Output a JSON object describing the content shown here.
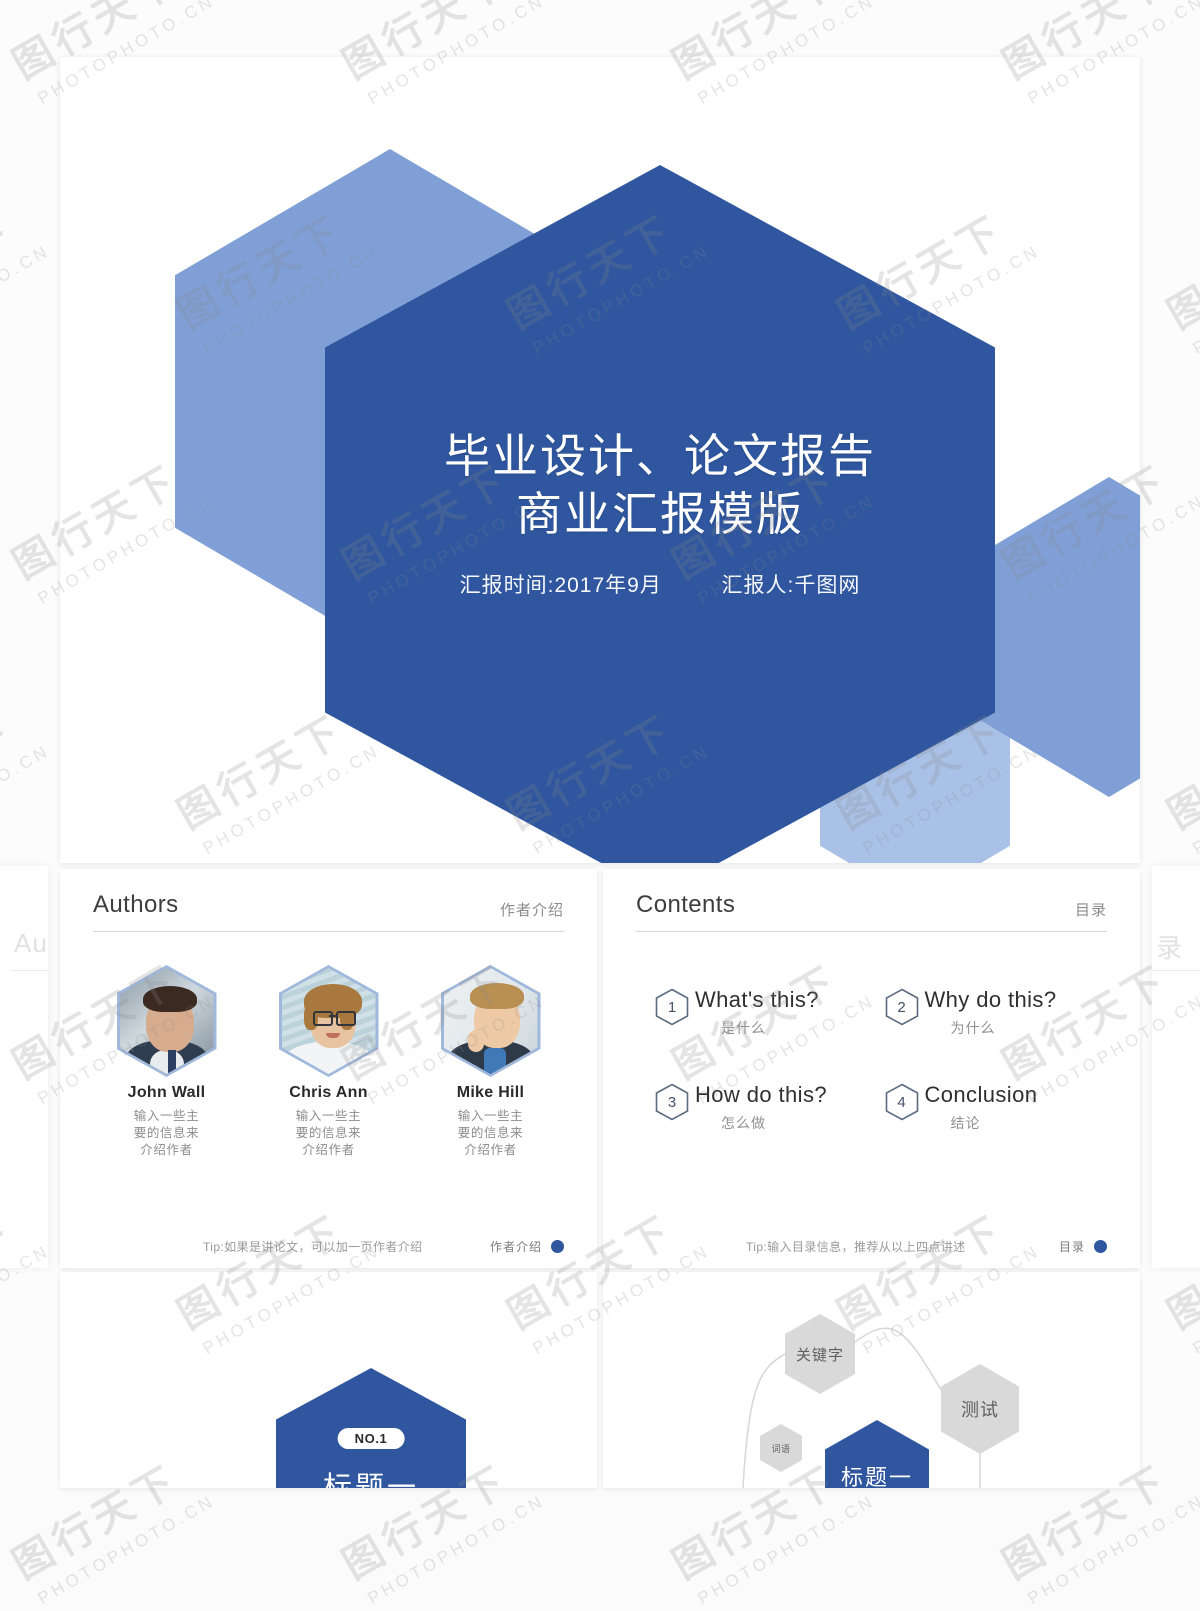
{
  "title_slide": {
    "heading_line1": "毕业设计、论文报告",
    "heading_line2": "商业汇报模版",
    "meta_date": "汇报时间:2017年9月",
    "meta_author": "汇报人:千图网",
    "colors": {
      "hex_main": "#2F569E",
      "hex_light": "#7F9FD6",
      "hex_lighter": "#A9C1E6"
    }
  },
  "authors_slide": {
    "heading_en": "Authors",
    "heading_cn": "作者介绍",
    "people": [
      {
        "name": "John Wall",
        "desc": "输入一些主\n要的信息来\n介绍作者"
      },
      {
        "name": "Chris Ann",
        "desc": "输入一些主\n要的信息来\n介绍作者"
      },
      {
        "name": "Mike Hill",
        "desc": "输入一些主\n要的信息来\n介绍作者"
      }
    ],
    "people_flat": [
      {
        "name": "John Wall",
        "l1": "输入一些主",
        "l2": "要的信息来",
        "l3": "介绍作者"
      },
      {
        "name": "Chris Ann",
        "l1": "输入一些主",
        "l2": "要的信息来",
        "l3": "介绍作者"
      },
      {
        "name": "Mike Hill",
        "l1": "输入一些主",
        "l2": "要的信息来",
        "l3": "介绍作者"
      }
    ],
    "tip": "Tip:如果是讲论文，可以加一页作者介绍",
    "footer_tag": "作者介绍"
  },
  "contents_slide": {
    "heading_en": "Contents",
    "heading_cn": "目录",
    "items": [
      {
        "num": "1",
        "en": "What's this?",
        "cn": "是什么"
      },
      {
        "num": "2",
        "en": "Why do this?",
        "cn": "为什么"
      },
      {
        "num": "3",
        "en": "How do this?",
        "cn": "怎么做"
      },
      {
        "num": "4",
        "en": "Conclusion",
        "cn": "结论"
      }
    ],
    "tip": "Tip:输入目录信息，推荐从以上四点讲述",
    "footer_tag": "目录"
  },
  "section_slide": {
    "badge": "NO.1",
    "title": "标题一"
  },
  "diagram_slide": {
    "nodes": [
      {
        "label": "关键字",
        "kind": "gray"
      },
      {
        "label": "测试",
        "kind": "gray"
      },
      {
        "label": "词语",
        "kind": "gray"
      },
      {
        "label": "标题一",
        "kind": "blue"
      }
    ]
  },
  "edge_slides": {
    "left_ghost": "Au",
    "right_ghost": "录"
  },
  "watermark": {
    "cn": "图行天下",
    "en": "PHOTOPHOTO.CN"
  }
}
